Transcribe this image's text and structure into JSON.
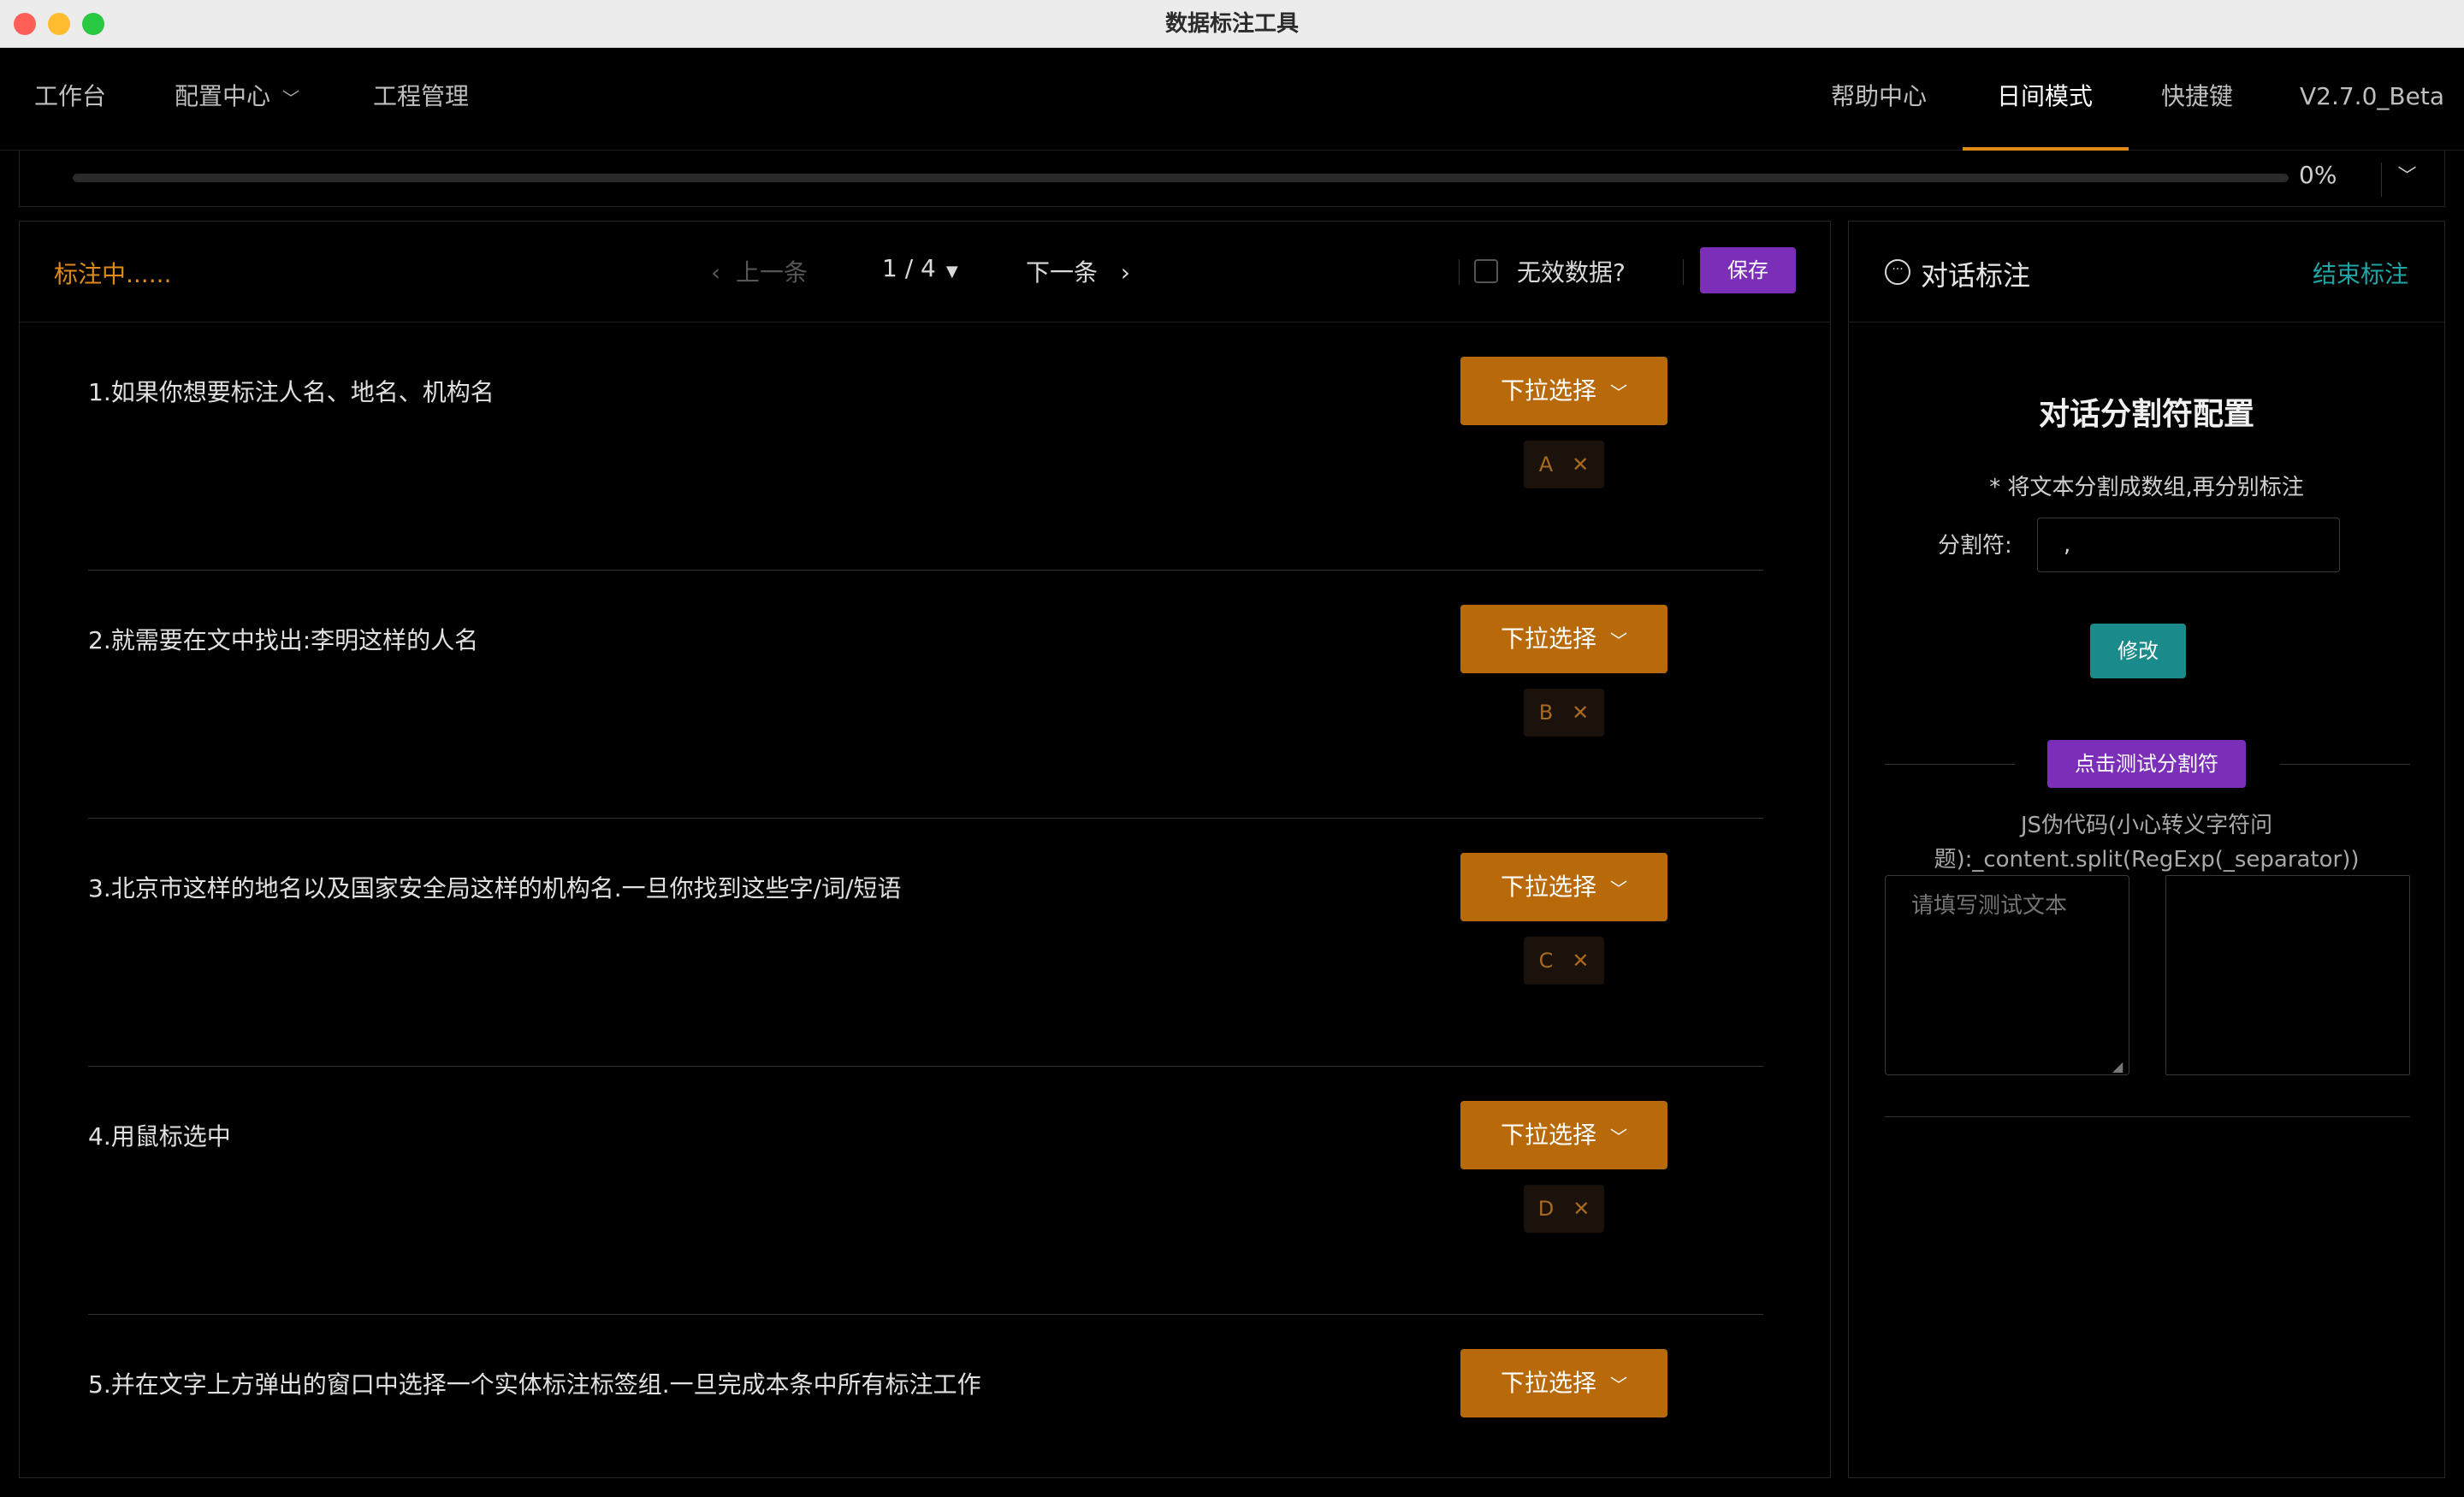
{
  "window": {
    "title": "数据标注工具"
  },
  "menu": {
    "workbench": "工作台",
    "config_center": "配置中心",
    "project_manage": "工程管理",
    "help": "帮助中心",
    "day_mode": "日间模式",
    "shortcuts": "快捷键",
    "version": "V2.7.0_Beta"
  },
  "progress": {
    "percent_label": "0%",
    "value": 0
  },
  "annotation": {
    "status": "标注中......",
    "prev_label": "上一条",
    "page": "1 / 4",
    "next_label": "下一条",
    "invalid_label": "无效数据?",
    "save_label": "保存",
    "dropdown_label": "下拉选择",
    "questions": [
      {
        "text": "1.如果你想要标注人名、地名、机构名",
        "tag": "A"
      },
      {
        "text": "2.就需要在文中找出:李明这样的人名",
        "tag": "B"
      },
      {
        "text": "3.北京市这样的地名以及国家安全局这样的机构名.一旦你找到这些字/词/短语",
        "tag": "C"
      },
      {
        "text": "4.用鼠标选中",
        "tag": "D"
      },
      {
        "text": "5.并在文字上方弹出的窗口中选择一个实体标注标签组.一旦完成本条中所有标注工作",
        "tag": ""
      }
    ]
  },
  "sidebar": {
    "title": "对话标注",
    "end_label": "结束标注",
    "config_title": "对话分割符配置",
    "config_hint": "* 将文本分割成数组,再分别标注",
    "separator_label": "分割符:",
    "separator_value": ",",
    "modify_label": "修改",
    "test_label": "点击测试分割符",
    "pseudo_line1": "JS伪代码(小心转义字符问",
    "pseudo_line2": "题):_content.split(RegExp(_separator))",
    "test_placeholder": "请填写测试文本"
  },
  "colors": {
    "accent": "#e08a1a",
    "dropdown": "#b86a0a",
    "save": "#7b2fb8",
    "teal": "#1a8a8a",
    "link_teal": "#1fa5a5"
  }
}
